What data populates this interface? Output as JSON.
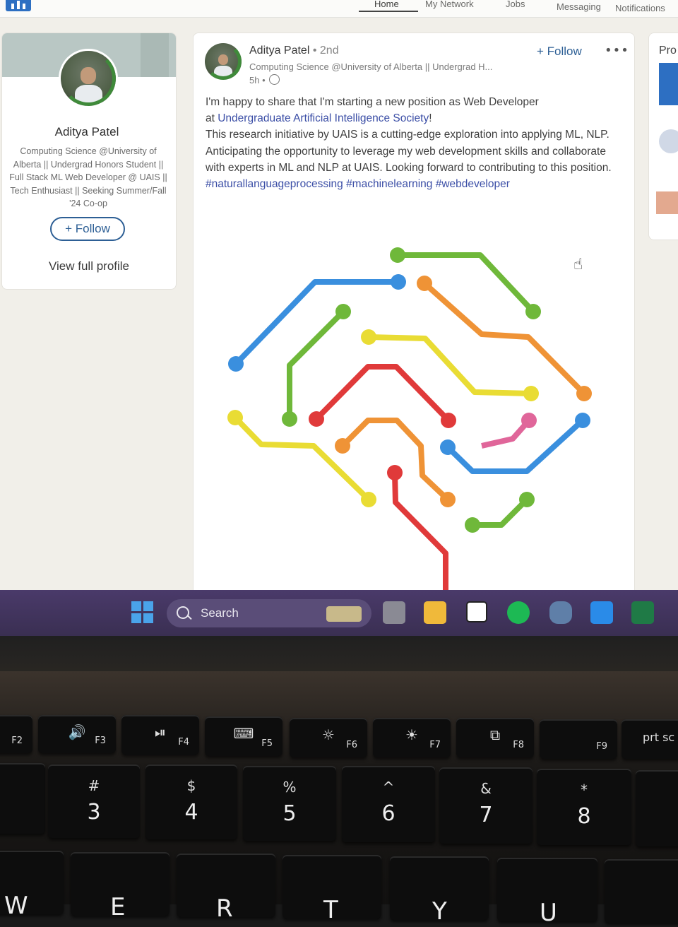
{
  "nav": {
    "items": [
      "Home",
      "My Network",
      "Jobs",
      "Messaging",
      "Notifications"
    ]
  },
  "profile": {
    "name": "Aditya Patel",
    "headline": "Computing Science @University of Alberta || Undergrad Honors Student || Full Stack ML Web Developer @ UAIS || Tech Enthusiast || Seeking Summer/Fall '24 Co-op",
    "follow_label": "+ Follow",
    "view_profile_label": "View full profile"
  },
  "post": {
    "author": "Aditya Patel",
    "degree": "• 2nd",
    "author_headline": "Computing Science @University of Alberta || Undergrad H...",
    "time": "5h •",
    "follow_label": "+ Follow",
    "more_label": "•••",
    "text_line1": "I'm happy to share that I'm starting a new position as Web Developer",
    "text_line2_prefix": "at ",
    "text_org": "Undergraduate Artificial Intelligence Society",
    "text_line2_suffix": "!",
    "text_line3": "This research initiative by UAIS is a cutting-edge exploration into applying ML, NLP. Anticipating the opportunity to leverage my web development skills and collaborate with experts in ML and NLP at UAIS. Looking forward to contributing to this position.",
    "hashtags": "#naturallanguageprocessing #machinelearning #webdeveloper"
  },
  "side": {
    "title": "Pro"
  },
  "taskbar": {
    "search_label": "Search"
  },
  "keyboard": {
    "fn_row": [
      {
        "sym": "",
        "fn": "F2"
      },
      {
        "sym": "🔊",
        "fn": "F3"
      },
      {
        "sym": "⏯",
        "fn": "F4"
      },
      {
        "sym": "⌨",
        "fn": "F5"
      },
      {
        "sym": "☼",
        "fn": "F6"
      },
      {
        "sym": "☀",
        "fn": "F7"
      },
      {
        "sym": "⧉",
        "fn": "F8"
      },
      {
        "sym": "",
        "fn": "F9"
      },
      {
        "sym": "",
        "fn": "prt sc"
      }
    ],
    "num_row": [
      {
        "top": "@",
        "num": ""
      },
      {
        "top": "#",
        "num": "3"
      },
      {
        "top": "$",
        "num": "4"
      },
      {
        "top": "%",
        "num": "5"
      },
      {
        "top": "^",
        "num": "6"
      },
      {
        "top": "&",
        "num": "7"
      },
      {
        "top": "*",
        "num": "8"
      },
      {
        "top": "(",
        "num": ""
      }
    ],
    "letter_row": [
      "W",
      "E",
      "R",
      "T",
      "Y",
      "U"
    ]
  },
  "colors": {
    "link": "#3b4ea6",
    "follow": "#2d5f95",
    "brain_blue": "#3a8fde",
    "brain_green": "#6fb83a",
    "brain_orange": "#ef9336",
    "brain_yellow": "#e9dc34",
    "brain_red": "#e03a3a",
    "brain_pink": "#e0669a"
  }
}
